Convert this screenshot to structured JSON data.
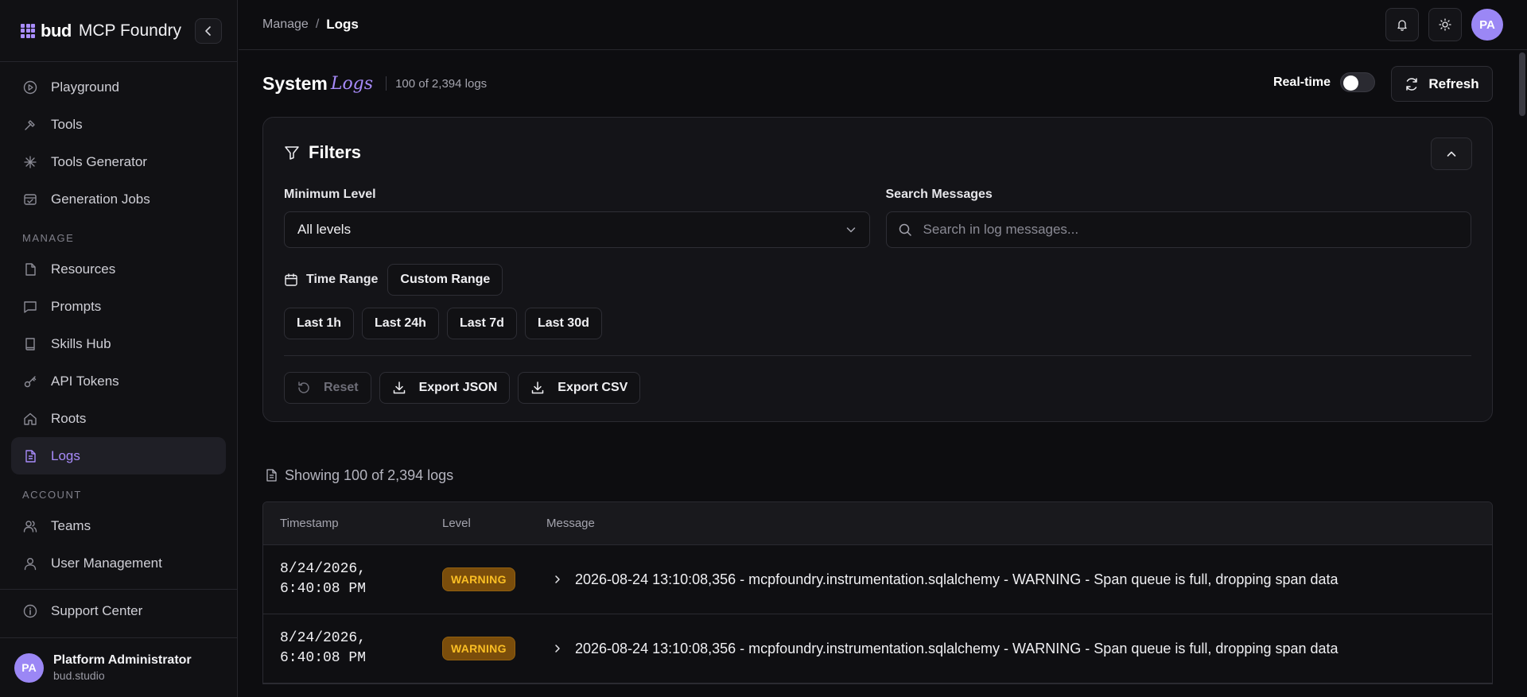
{
  "brand": {
    "bud": "bud",
    "name": "MCP Foundry"
  },
  "sidebar": {
    "main_items": [
      {
        "label": "Playground",
        "icon": "play-icon"
      },
      {
        "label": "Tools",
        "icon": "hammer-icon"
      },
      {
        "label": "Tools Generator",
        "icon": "sparkle-icon"
      },
      {
        "label": "Generation Jobs",
        "icon": "checklist-icon"
      }
    ],
    "manage_section": "MANAGE",
    "manage_items": [
      {
        "label": "Resources",
        "icon": "file-icon"
      },
      {
        "label": "Prompts",
        "icon": "chat-icon"
      },
      {
        "label": "Skills Hub",
        "icon": "book-icon"
      },
      {
        "label": "API Tokens",
        "icon": "key-icon"
      },
      {
        "label": "Roots",
        "icon": "home-icon"
      },
      {
        "label": "Logs",
        "icon": "file-text-icon",
        "active": true
      }
    ],
    "account_section": "ACCOUNT",
    "account_items": [
      {
        "label": "Teams",
        "icon": "users-icon"
      },
      {
        "label": "User Management",
        "icon": "user-icon"
      }
    ],
    "support": {
      "label": "Support Center",
      "icon": "info-icon"
    },
    "user": {
      "initials": "PA",
      "name": "Platform Administrator",
      "org": "bud.studio"
    }
  },
  "topbar": {
    "breadcrumb_parent": "Manage",
    "breadcrumb_sep": "/",
    "breadcrumb_current": "Logs",
    "avatar_initials": "PA"
  },
  "page": {
    "title_main": "System",
    "title_accent": "Logs",
    "count": "100 of 2,394 logs",
    "realtime_label": "Real-time",
    "realtime_on": false,
    "refresh_label": "Refresh"
  },
  "filters": {
    "title": "Filters",
    "min_level_label": "Minimum Level",
    "min_level_value": "All levels",
    "search_label": "Search Messages",
    "search_placeholder": "Search in log messages...",
    "time_range_label": "Time Range",
    "custom_range": "Custom Range",
    "presets": [
      "Last 1h",
      "Last 24h",
      "Last 7d",
      "Last 30d"
    ],
    "reset": "Reset",
    "export_json": "Export JSON",
    "export_csv": "Export CSV"
  },
  "results": {
    "showing": "Showing 100 of 2,394 logs",
    "columns": {
      "timestamp": "Timestamp",
      "level": "Level",
      "message": "Message"
    },
    "rows": [
      {
        "date": "8/24/2026,",
        "time": "6:40:08 PM",
        "level": "WARNING",
        "message": "2026-08-24 13:10:08,356 - mcpfoundry.instrumentation.sqlalchemy - WARNING - Span queue is full, dropping span data"
      },
      {
        "date": "8/24/2026,",
        "time": "6:40:08 PM",
        "level": "WARNING",
        "message": "2026-08-24 13:10:08,356 - mcpfoundry.instrumentation.sqlalchemy - WARNING - Span queue is full, dropping span data"
      }
    ]
  },
  "colors": {
    "accent": "#a78bfa",
    "warning_bg": "#7a4d0b",
    "warning_text": "#fbbf24"
  }
}
